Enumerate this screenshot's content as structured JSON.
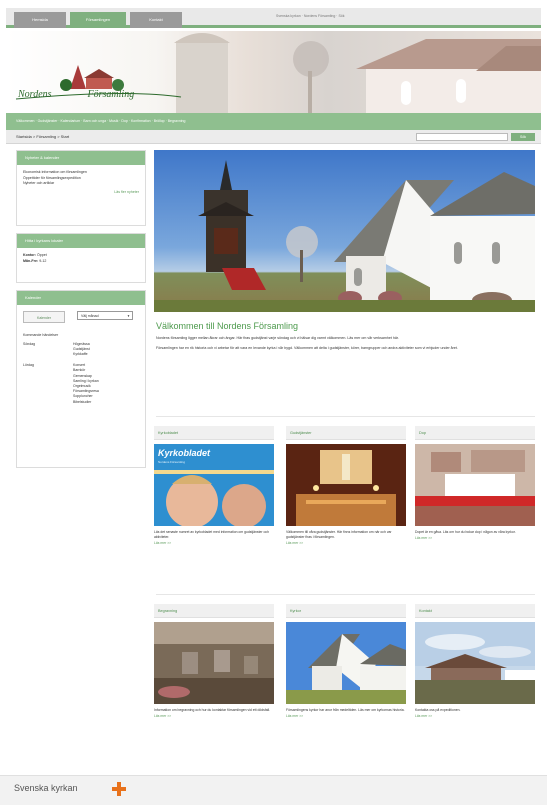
{
  "top_tabs": [
    "Hemsida",
    "Församlingen",
    "Kontakt"
  ],
  "top_strip_text": "Svenska kyrkan · Nordens Församling · Sök",
  "banner": {
    "logo_word_1": "Nordens",
    "logo_word_2": "Församling"
  },
  "nav_strip_text": "Välkommen · Gudstjänster · Kalendarium · Barn och unga · Musik · Dop · Konfirmation · Bröllop · Begravning",
  "breadcrumb": "Startsida > Församling > Start",
  "search": {
    "placeholder": "",
    "button_label": "Sök"
  },
  "sidebar": {
    "box1": {
      "title": "Nyheter & kalender",
      "lines": [
        "Ekonomisk information om församlingen",
        "Öppettider för församlingsexpedition",
        "Nyheter och artiklar"
      ],
      "link": "Läs fler nyheter"
    },
    "box2": {
      "title": "Hitta i kyrkans lokaler",
      "lines": [
        {
          "label": "Kontor:",
          "value": "Öppet"
        },
        {
          "label": "Mån-Fre:",
          "value": "9-12"
        }
      ]
    },
    "box3": {
      "title": "Kalender",
      "tab_label": "Kalender",
      "select_value": "Välj månad",
      "heading": "Kommande händelser",
      "rows": [
        {
          "date": "Söndag",
          "items": [
            "Högmässa",
            "Gudstjänst",
            "Kyrkkaffe"
          ]
        },
        {
          "date": "Lördag",
          "items": [
            "Konsert",
            "Barnkör",
            "Gemenskap",
            "Samling i kyrkan",
            "Orgelmusik",
            "Församlingsresa",
            "Soppluncher",
            "Bibelstudier"
          ]
        }
      ]
    }
  },
  "welcome": {
    "title": "Välkommen till Nordens Församling",
    "p1": "Nordens församling ligger mellan åkrar och ängar. Här firas gudstjänst varje söndag och vi hälsar dig varmt välkommen. Läs mer om vår verksamhet här.",
    "p2": "Församlingen har en rik historia och vi arbetar för att vara en levande kyrka i vår bygd. Välkommen att delta i gudstjänster, körer, barngrupper och andra aktiviteter som vi erbjuder under året."
  },
  "cards_row1": [
    {
      "head": "Kyrkobladet",
      "text": "Läs det senaste numret av kyrkobladet med information om gudstjänster och aktiviteter.",
      "link": "Läs mer >>",
      "magazine_title": "Kyrkobladet",
      "magazine_subtitle": "Nordens Församling"
    },
    {
      "head": "Gudstjänster",
      "text": "Välkommen till våra gudstjänster. Här finns information om när och var gudstjänster firas i församlingen.",
      "link": "Läs mer >>"
    },
    {
      "head": "Dop",
      "text": "Dopet är en gåva. Läs om hur du bokar dop i någon av våra kyrkor.",
      "link": "Läs mer >>"
    }
  ],
  "cards_row2": [
    {
      "head": "Begravning",
      "text": "Information om begravning och hur du kontaktar församlingen vid ett dödsfall.",
      "link": "Läs mer >>"
    },
    {
      "head": "Kyrkor",
      "text": "Församlingens kyrkor har anor från medeltiden. Läs mer om kyrkornas historia.",
      "link": "Läs mer >>"
    },
    {
      "head": "Kontakt",
      "text": "Kontakta oss på expeditionen.",
      "link": "Läs mer >>"
    }
  ],
  "footer": {
    "logo_text": "Svenska kyrkan"
  },
  "colors": {
    "green": "#7fb07f",
    "dark_green": "#4d9a4d",
    "footer_orange": "#e8721c"
  }
}
